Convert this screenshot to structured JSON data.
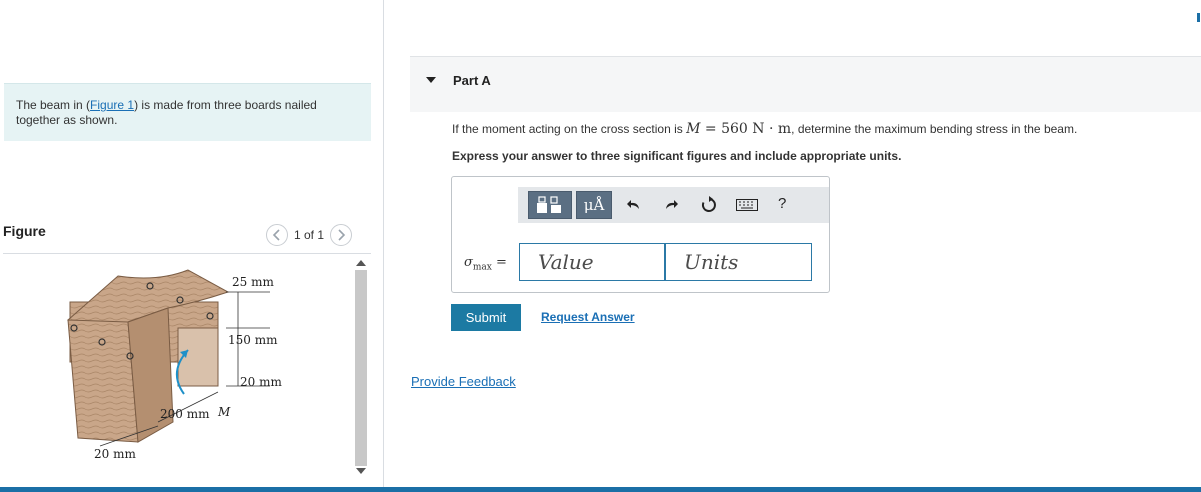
{
  "intro": {
    "text_before": "The beam in (",
    "figure_link": "Figure 1",
    "text_after": ") is made from three boards nailed together as shown."
  },
  "figure": {
    "title": "Figure",
    "pager_text": "1 of 1",
    "prev_icon": "chevron-left-icon",
    "next_icon": "chevron-right-icon",
    "labels": {
      "top_thickness": "25 mm",
      "web_height": "150 mm",
      "bottom_thickness": "20 mm",
      "width": "200 mm",
      "moment": "M",
      "web_thickness": "20 mm"
    }
  },
  "part": {
    "label": "Part A",
    "question_before": "If the moment acting on the cross section is ",
    "question_math_var": "M",
    "question_math_rest": " = 560 N · m",
    "question_after": ", determine the maximum bending stress in the beam.",
    "instruction": "Express your answer to three significant figures and include appropriate units."
  },
  "answer": {
    "lhs_symbol": "σ",
    "lhs_sub": "max",
    "lhs_eq": " =",
    "value_placeholder": "Value",
    "units_placeholder": "Units",
    "toolbar": {
      "templates_icon": "templates-icon",
      "units_label": "μÅ",
      "undo_icon": "undo-icon",
      "redo_icon": "redo-icon",
      "reset_icon": "reset-icon",
      "keyboard_icon": "keyboard-icon",
      "help_label": "?"
    }
  },
  "actions": {
    "submit": "Submit",
    "request_answer": "Request Answer",
    "feedback": "Provide Feedback"
  },
  "colors": {
    "accent": "#1c7aa3",
    "link": "#1a6fb5",
    "intro_bg": "#e6f3f4",
    "toolbar_bg": "#e4e7ea",
    "toolbar_btn": "#5b6f83",
    "wood": "#c9a689"
  }
}
